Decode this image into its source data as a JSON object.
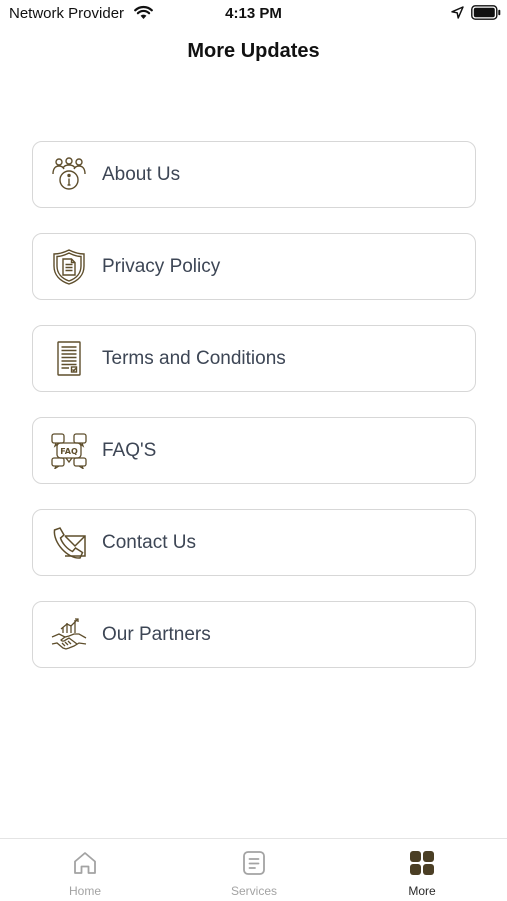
{
  "status_bar": {
    "carrier": "Network Provider",
    "time": "4:13 PM"
  },
  "header": {
    "title": "More Updates"
  },
  "menu": {
    "items": [
      {
        "label": "About Us",
        "icon": "about-us-icon"
      },
      {
        "label": "Privacy Policy",
        "icon": "privacy-shield-icon"
      },
      {
        "label": "Terms and Conditions",
        "icon": "terms-document-icon"
      },
      {
        "label": "FAQ'S",
        "icon": "faq-chat-icon"
      },
      {
        "label": "Contact Us",
        "icon": "contact-phone-mail-icon"
      },
      {
        "label": "Our Partners",
        "icon": "partners-handshake-icon"
      }
    ]
  },
  "tab_bar": {
    "tabs": [
      {
        "label": "Home",
        "icon": "home-icon",
        "active": false
      },
      {
        "label": "Services",
        "icon": "services-icon",
        "active": false
      },
      {
        "label": "More",
        "icon": "more-grid-icon",
        "active": true
      }
    ]
  },
  "colors": {
    "icon_brown": "#5e4e2c",
    "label_gray": "#3d4655",
    "border": "#d7d7d7",
    "tab_inactive": "#a3a3a3",
    "tab_active": "#2a2a2a"
  }
}
